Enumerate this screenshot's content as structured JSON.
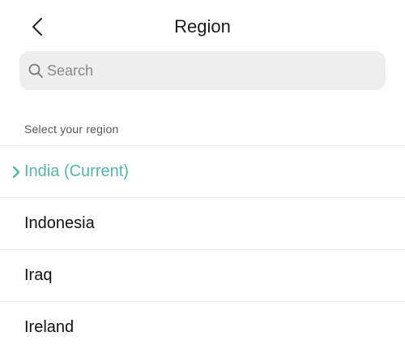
{
  "header": {
    "title": "Region",
    "back_icon": "chevron-left-icon"
  },
  "search": {
    "placeholder": "Search",
    "value": "",
    "icon": "search-icon"
  },
  "section": {
    "label": "Select your region"
  },
  "regions": [
    {
      "label": "India (Current)",
      "selected": true
    },
    {
      "label": "Indonesia",
      "selected": false
    },
    {
      "label": "Iraq",
      "selected": false
    },
    {
      "label": "Ireland",
      "selected": false
    }
  ],
  "colors": {
    "accent": "#55b5a9",
    "search_bg": "#eeeeee",
    "divider": "#ececec"
  }
}
